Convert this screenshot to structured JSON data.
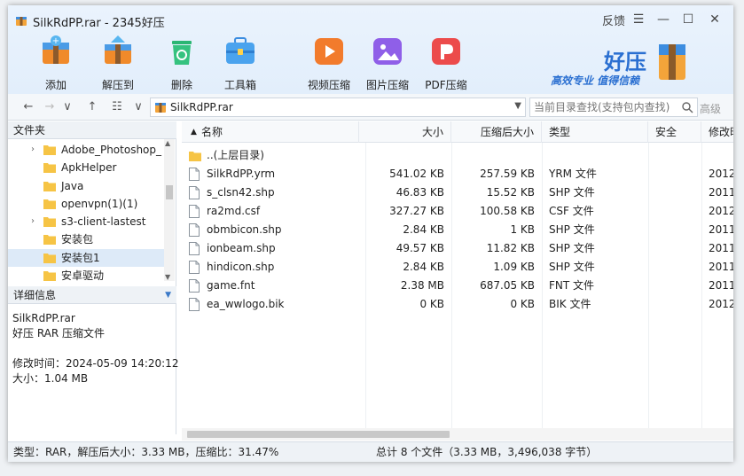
{
  "window": {
    "title": "SilkRdPP.rar - 2345好压",
    "feedback_label": "反馈",
    "menu_glyph": "☰",
    "minimize_glyph": "—",
    "maximize_glyph": "☐",
    "close_glyph": "✕"
  },
  "toolbar": {
    "add_label": "添加",
    "extract_label": "解压到",
    "delete_label": "删除",
    "toolbox_label": "工具箱",
    "video_compress_label": "视频压缩",
    "image_compress_label": "图片压缩",
    "pdf_compress_label": "PDF压缩"
  },
  "brand": {
    "name": "好压",
    "slogan": "高效专业 值得信赖"
  },
  "address": {
    "path": "SilkRdPP.rar",
    "search_placeholder": "当前目录查找(支持包内查找)",
    "advanced_label": "高级"
  },
  "left_panel": {
    "folders_header": "文件夹",
    "tree": [
      {
        "label": "Adobe_Photoshop_",
        "expandable": true,
        "selected": false
      },
      {
        "label": "ApkHelper",
        "expandable": false,
        "selected": false
      },
      {
        "label": "Java",
        "expandable": false,
        "selected": false
      },
      {
        "label": "openvpn(1)(1)",
        "expandable": false,
        "selected": false
      },
      {
        "label": "s3-client-lastest",
        "expandable": true,
        "selected": false
      },
      {
        "label": "安装包",
        "expandable": false,
        "selected": false
      },
      {
        "label": "安装包1",
        "expandable": false,
        "selected": true
      },
      {
        "label": "安卓驱动",
        "expandable": false,
        "selected": false
      }
    ],
    "details_header": "详细信息",
    "details": {
      "filename": "SilkRdPP.rar",
      "filetype": "好压 RAR 压缩文件",
      "modified": "修改时间：2024-05-09 14:20:12",
      "size": "大小：1.04 MB"
    }
  },
  "list": {
    "columns": {
      "name": "名称",
      "size": "大小",
      "packed": "压缩后大小",
      "type": "类型",
      "security": "安全",
      "modified": "修改时"
    },
    "parent_label": "..(上层目录)",
    "rows": [
      {
        "name": "SilkRdPP.yrm",
        "size": "541.02 KB",
        "packed": "257.59 KB",
        "type": "YRM 文件",
        "modified": "2012-"
      },
      {
        "name": "s_clsn42.shp",
        "size": "46.83 KB",
        "packed": "15.52 KB",
        "type": "SHP 文件",
        "modified": "2011-"
      },
      {
        "name": "ra2md.csf",
        "size": "327.27 KB",
        "packed": "100.58 KB",
        "type": "CSF 文件",
        "modified": "2012-"
      },
      {
        "name": "obmbicon.shp",
        "size": "2.84 KB",
        "packed": "1 KB",
        "type": "SHP 文件",
        "modified": "2011-"
      },
      {
        "name": "ionbeam.shp",
        "size": "49.57 KB",
        "packed": "11.82 KB",
        "type": "SHP 文件",
        "modified": "2011-"
      },
      {
        "name": "hindicon.shp",
        "size": "2.84 KB",
        "packed": "1.09 KB",
        "type": "SHP 文件",
        "modified": "2011-"
      },
      {
        "name": "game.fnt",
        "size": "2.38 MB",
        "packed": "687.05 KB",
        "type": "FNT 文件",
        "modified": "2011-"
      },
      {
        "name": "ea_wwlogo.bik",
        "size": "0 KB",
        "packed": "0 KB",
        "type": "BIK 文件",
        "modified": "2012-"
      }
    ]
  },
  "status": {
    "left": "类型：RAR，解压后大小：3.33 MB，压缩比：31.47%",
    "right": "总计 8 个文件（3.33 MB，3,496,038 字节）"
  }
}
